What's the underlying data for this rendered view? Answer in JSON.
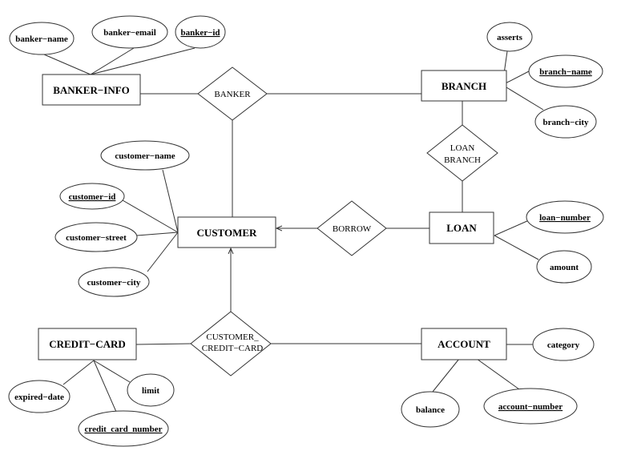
{
  "entities": {
    "banker_info": "BANKER−INFO",
    "branch": "BRANCH",
    "customer": "CUSTOMER",
    "loan": "LOAN",
    "credit_card": "CREDIT−CARD",
    "account": "ACCOUNT"
  },
  "relationships": {
    "banker": "BANKER",
    "loan_branch_1": "LOAN",
    "loan_branch_2": "BRANCH",
    "borrow": "BORROW",
    "customer_credit_card_1": "CUSTOMER_",
    "customer_credit_card_2": "CREDIT−CARD"
  },
  "attributes": {
    "banker_name": "banker−name",
    "banker_email": "banker−email",
    "banker_id": "banker−id",
    "asserts": "asserts",
    "branch_name": "branch−name",
    "branch_city": "branch−city",
    "customer_name": "customer−name",
    "customer_id": "customer−id",
    "customer_street": "customer−street",
    "customer_city": "customer−city",
    "loan_number": "loan−number",
    "amount": "amount",
    "category": "category",
    "balance": "balance",
    "account_number": "account−number",
    "expired_date": "expired−date",
    "limit": "limit",
    "credit_card_number": "credit_card_number"
  },
  "key_attributes": [
    "banker_id",
    "branch_name",
    "customer_id",
    "loan_number",
    "account_number",
    "credit_card_number"
  ]
}
